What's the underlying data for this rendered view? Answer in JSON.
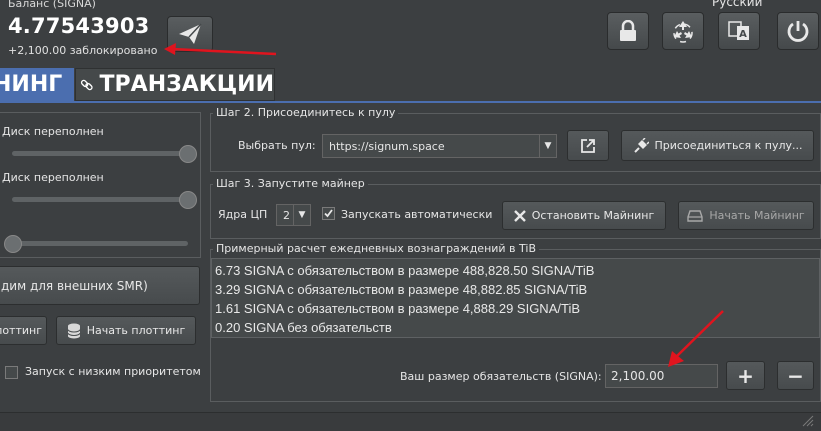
{
  "header": {
    "balance_label": "Баланс (SIGNA)",
    "balance_value": "4.77543903",
    "locked_text": "+2,100.00 заблокировано",
    "language": "Русский",
    "icons": [
      "send-icon",
      "lock-icon",
      "recycle-icon",
      "translate-icon",
      "power-icon"
    ]
  },
  "tabs": {
    "mining": "НИНГ",
    "transactions": "ТРАНЗАКЦИИ"
  },
  "left": {
    "disk1": "Диск переполнен",
    "disk2": "Диск переполнен",
    "smr_button": "дим для внешних SMR)",
    "stop_plot_button": "лоттинг",
    "start_plot_button": "Начать плоттинг",
    "low_priority": "Запуск с низким приоритетом"
  },
  "step2": {
    "legend": "Шаг 2. Присоединитесь к пулу",
    "pool_label": "Выбрать пул:",
    "pool_value": "https://signum.space",
    "join_button": "Присоединиться к пулу..."
  },
  "step3": {
    "legend": "Шаг 3. Запустите майнер",
    "cores_label": "Ядра ЦП",
    "cores_value": "2",
    "autostart_label": "Запускать автоматически",
    "autostart_checked": true,
    "stop_button": "Остановить Майнинг",
    "start_button": "Начать Майнинг"
  },
  "estimate": {
    "legend": "Примерный расчет ежедневных вознаграждений в TiB",
    "lines": [
      "6.73 SIGNA с обязательством в размере 488,828.50 SIGNA/TiB",
      "3.29 SIGNA с обязательством в размере 48,882.85 SIGNA/TiB",
      "1.61 SIGNA с обязательством в размере 4,888.29 SIGNA/TiB",
      "0.20 SIGNA без обязательств"
    ],
    "commitment_label": "Ваш размер обязательств (SIGNA):",
    "commitment_value": "2,100.00",
    "plus": "+",
    "minus": "−"
  },
  "colors": {
    "accent": "#4b6eaf",
    "background": "#3c3f41",
    "annotation": "#e0141e"
  }
}
